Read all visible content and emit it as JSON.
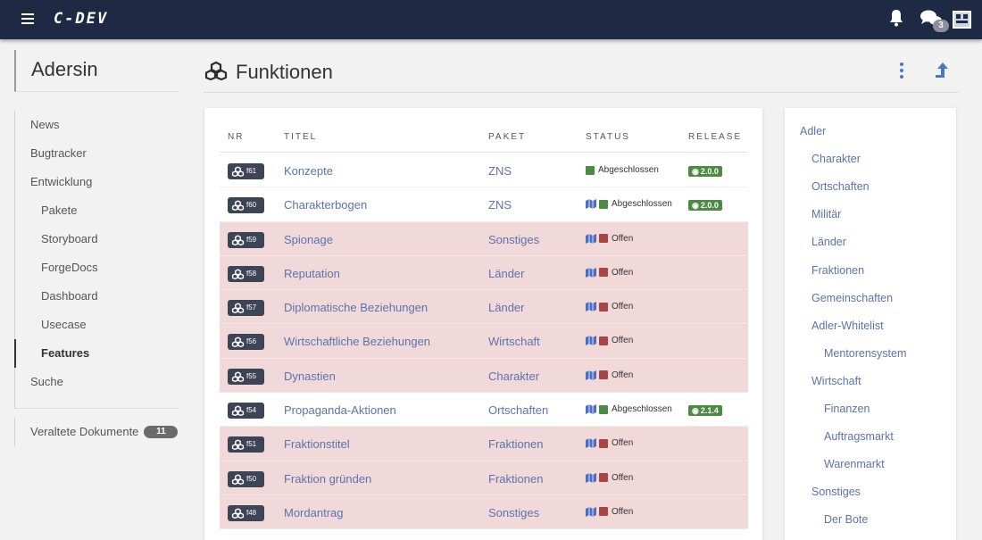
{
  "app": {
    "logo": "C-DEV"
  },
  "header": {
    "chat_count": "3"
  },
  "sidebar": {
    "project": "Adersin",
    "items": [
      {
        "label": "News",
        "sub": false,
        "active": false
      },
      {
        "label": "Bugtracker",
        "sub": false,
        "active": false
      },
      {
        "label": "Entwicklung",
        "sub": false,
        "active": false
      },
      {
        "label": "Pakete",
        "sub": true,
        "active": false
      },
      {
        "label": "Storyboard",
        "sub": true,
        "active": false
      },
      {
        "label": "ForgeDocs",
        "sub": true,
        "active": false
      },
      {
        "label": "Dashboard",
        "sub": true,
        "active": false
      },
      {
        "label": "Usecase",
        "sub": true,
        "active": false
      },
      {
        "label": "Features",
        "sub": true,
        "active": true
      },
      {
        "label": "Suche",
        "sub": false,
        "active": false
      }
    ],
    "outdated": {
      "label": "Veraltete Dokumente",
      "count": "11"
    }
  },
  "page": {
    "title": "Funktionen"
  },
  "table": {
    "headers": {
      "nr": "NR",
      "titel": "TITEL",
      "paket": "PAKET",
      "status": "STATUS",
      "release": "RELEASE"
    },
    "rows": [
      {
        "nr": "f61",
        "title": "Konzepte",
        "paket": "ZNS",
        "status": "Abgeschlossen",
        "map": false,
        "release": "2.0.0"
      },
      {
        "nr": "f60",
        "title": "Charakterbogen",
        "paket": "ZNS",
        "status": "Abgeschlossen",
        "map": true,
        "release": "2.0.0"
      },
      {
        "nr": "f59",
        "title": "Spionage",
        "paket": "Sonstiges",
        "status": "Offen",
        "map": true,
        "release": ""
      },
      {
        "nr": "f58",
        "title": "Reputation",
        "paket": "Länder",
        "status": "Offen",
        "map": true,
        "release": ""
      },
      {
        "nr": "f57",
        "title": "Diplomatische Beziehungen",
        "paket": "Länder",
        "status": "Offen",
        "map": true,
        "release": ""
      },
      {
        "nr": "f56",
        "title": "Wirtschaftliche Beziehungen",
        "paket": "Wirtschaft",
        "status": "Offen",
        "map": true,
        "release": ""
      },
      {
        "nr": "f55",
        "title": "Dynastien",
        "paket": "Charakter",
        "status": "Offen",
        "map": true,
        "release": ""
      },
      {
        "nr": "f54",
        "title": "Propaganda-Aktionen",
        "paket": "Ortschaften",
        "status": "Abgeschlossen",
        "map": true,
        "release": "2.1.4"
      },
      {
        "nr": "f51",
        "title": "Fraktionstitel",
        "paket": "Fraktionen",
        "status": "Offen",
        "map": true,
        "release": ""
      },
      {
        "nr": "f50",
        "title": "Fraktion gründen",
        "paket": "Fraktionen",
        "status": "Offen",
        "map": true,
        "release": ""
      },
      {
        "nr": "f48",
        "title": "Mordantrag",
        "paket": "Sonstiges",
        "status": "Offen",
        "map": true,
        "release": ""
      }
    ]
  },
  "toc": [
    {
      "label": "Adler",
      "level": 0
    },
    {
      "label": "Charakter",
      "level": 1
    },
    {
      "label": "Ortschaften",
      "level": 1
    },
    {
      "label": "Militär",
      "level": 1
    },
    {
      "label": "Länder",
      "level": 1
    },
    {
      "label": "Fraktionen",
      "level": 1
    },
    {
      "label": "Gemeinschaften",
      "level": 1
    },
    {
      "label": "Adler-Whitelist",
      "level": 1
    },
    {
      "label": "Mentorensystem",
      "level": 2
    },
    {
      "label": "Wirtschaft",
      "level": 1
    },
    {
      "label": "Finanzen",
      "level": 2
    },
    {
      "label": "Auftragsmarkt",
      "level": 2
    },
    {
      "label": "Warenmarkt",
      "level": 2
    },
    {
      "label": "Sonstiges",
      "level": 1
    },
    {
      "label": "Der Bote",
      "level": 2
    }
  ],
  "colors": {
    "topbar": "#1e2a44",
    "link": "#5b73ad",
    "open_row": "#f1d9d9",
    "done": "#4d8a44",
    "open": "#a84545"
  },
  "icons": {
    "menu": "hamburger-icon",
    "bell": "bell-icon",
    "chat": "chat-icon",
    "feature": "cubes-icon",
    "map": "map-icon",
    "more": "kebab-icon",
    "upload": "upload-icon"
  }
}
